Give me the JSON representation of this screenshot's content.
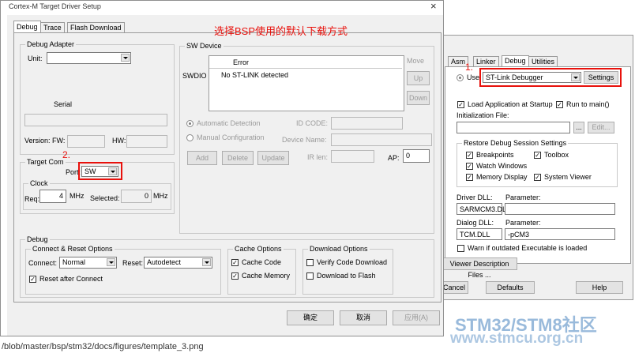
{
  "main_dialog": {
    "title": "Cortex-M Target Driver Setup",
    "close": "×",
    "tabs": [
      "Debug",
      "Trace",
      "Flash Download"
    ],
    "annotation_text": "选择BSP使用的默认下载方式",
    "debug_adapter": {
      "title": "Debug Adapter",
      "unit_label": "Unit:",
      "unit_value": "",
      "serial_label": "Serial",
      "serial_value": "",
      "version_fw_label": "Version: FW:",
      "version_fw_value": "",
      "hw_label": "HW:",
      "hw_value": ""
    },
    "target_com": {
      "title": "Target Com",
      "port_label": "Port:",
      "port_value": "SW",
      "marker": "2.",
      "clock": {
        "title": "Clock",
        "req_label": "Req:",
        "req_value": "4",
        "req_unit": "MHz",
        "selected_label": "Selected:",
        "selected_value": "0",
        "selected_unit": "MHz"
      }
    },
    "sw_device": {
      "title": "SW Device",
      "row_label": "SWDIO",
      "column_header": "Error",
      "row_value": "No ST-LINK detected",
      "side_buttons": [
        "Move",
        "Up",
        "Down"
      ],
      "automatic_detection": "Automatic Detection",
      "manual_configuration": "Manual Configuration",
      "id_code_label": "ID CODE:",
      "device_name_label": "Device Name:",
      "ir_len_label": "IR len:",
      "ap_label": "AP:",
      "ap_value": "0",
      "buttons": [
        "Add",
        "Delete",
        "Update"
      ]
    },
    "debug": {
      "title": "Debug",
      "connect_reset": {
        "title": "Connect & Reset Options",
        "connect_label": "Connect:",
        "connect_value": "Normal",
        "reset_label": "Reset:",
        "reset_value": "Autodetect",
        "reset_after_connect": "Reset after Connect"
      },
      "cache": {
        "title": "Cache Options",
        "cache_code": "Cache Code",
        "cache_memory": "Cache Memory"
      },
      "download": {
        "title": "Download Options",
        "verify_code": "Verify Code Download",
        "download_flash": "Download to Flash"
      }
    },
    "footer_buttons": [
      "确定",
      "取消",
      "应用(A)"
    ]
  },
  "options_dialog": {
    "tabs": [
      "Asm",
      "Linker",
      "Debug",
      "Utilities"
    ],
    "marker": "1.",
    "use_label": "Use:",
    "debugger_value": "ST-Link Debugger",
    "settings_button": "Settings",
    "load_application": "Load Application at Startup",
    "run_to_main": "Run to main()",
    "init_file_label": "Initialization File:",
    "browse_button": "...",
    "edit_button": "Edit...",
    "restore": {
      "title": "Restore Debug Session Settings",
      "breakpoints": "Breakpoints",
      "toolbox": "Toolbox",
      "watch_windows": "Watch Windows",
      "memory_display": "Memory Display",
      "system_viewer": "System Viewer"
    },
    "driver_dll_label": "Driver DLL:",
    "driver_parameter_label": "Parameter:",
    "driver_dll_value": "SARMCM3.DLL",
    "driver_parameter_value": "",
    "dialog_dll_label": "Dialog DLL:",
    "dialog_parameter_label": "Parameter:",
    "dialog_dll_value": "TCM.DLL",
    "dialog_parameter_value": "-pCM3",
    "warn_outdated": "Warn if outdated Executable is loaded",
    "viewer_description": "Viewer Description Files ...",
    "footer_buttons": [
      "Cancel",
      "Defaults",
      "Help"
    ]
  },
  "status_url": "/blob/master/bsp/stm32/docs/figures/template_3.png",
  "watermark": {
    "line1": "STM32/STM8社区",
    "line2": "www.stmcu.org.cn"
  }
}
